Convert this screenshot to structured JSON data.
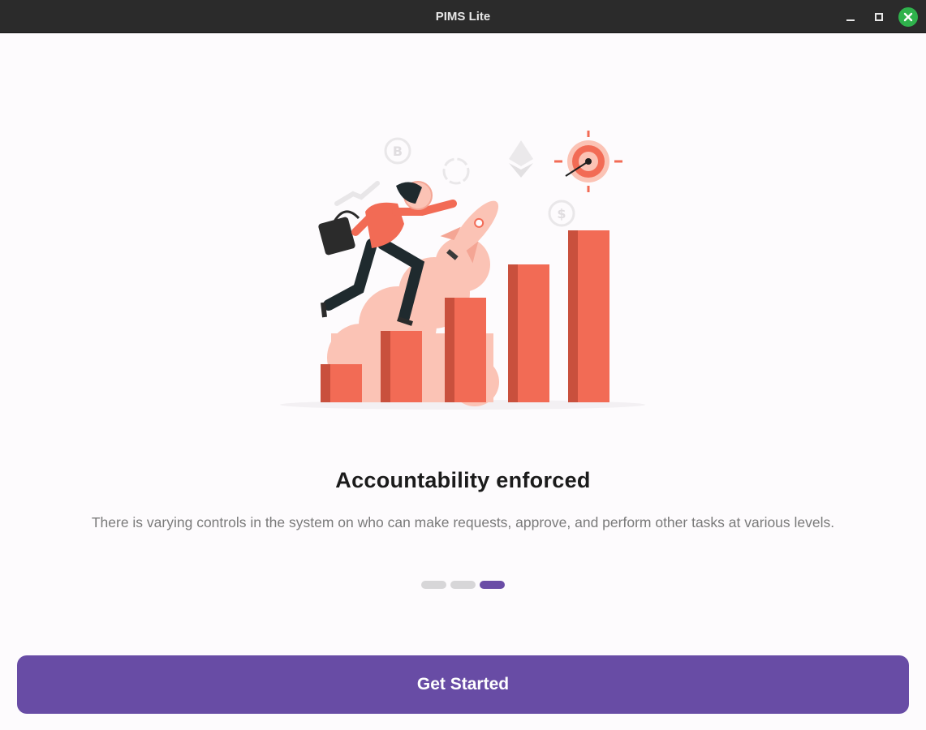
{
  "window": {
    "title": "PIMS Lite",
    "controls": [
      "minimize-icon",
      "maximize-icon",
      "close-icon"
    ],
    "close_color": "#2fb24c"
  },
  "onboarding": {
    "illustration": "person-climbing-bar-chart-with-rocket-illustration",
    "heading": "Accountability enforced",
    "description": "There is varying controls in the system on who can make requests, approve, and perform other tasks at various levels.",
    "pagination": {
      "total": 3,
      "active_index": 2,
      "active_color": "#6a4ca6",
      "inactive_color": "#d7d6d8"
    },
    "cta_label": "Get Started",
    "cta_color": "#684ca5"
  },
  "colors": {
    "accent": "#684ca5",
    "illustration_primary": "#f26b55",
    "illustration_light": "#fbc3b5"
  }
}
